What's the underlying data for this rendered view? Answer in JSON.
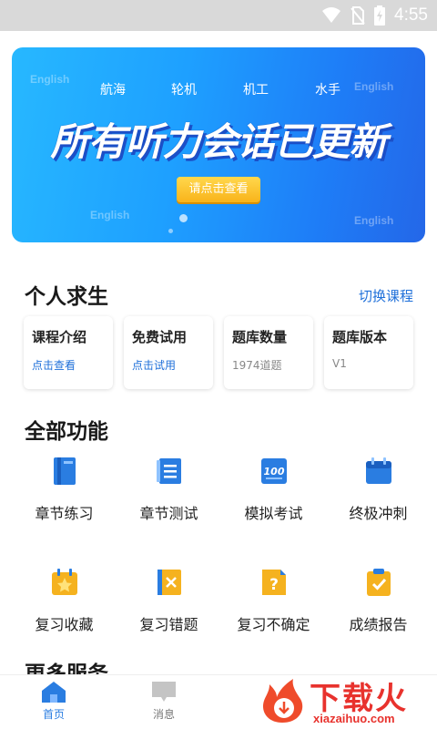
{
  "statusbar": {
    "time": "4:55",
    "icons": [
      "wifi-icon",
      "no-sim-icon",
      "battery-charging-icon"
    ]
  },
  "banner": {
    "watermark": "English",
    "categories": [
      "航海",
      "轮机",
      "机工",
      "水手"
    ],
    "headline": "所有听力会话已更新",
    "cta": "请点击查看"
  },
  "course": {
    "title": "个人求生",
    "switch_label": "切换课程",
    "cards": [
      {
        "title": "课程介绍",
        "sub": "点击查看"
      },
      {
        "title": "免费试用",
        "sub": "点击试用"
      },
      {
        "title": "题库数量",
        "sub": "1974道题"
      },
      {
        "title": "题库版本",
        "sub": "V1"
      }
    ]
  },
  "functions": {
    "title": "全部功能",
    "items": [
      {
        "label": "章节练习",
        "icon": "book-icon"
      },
      {
        "label": "章节测试",
        "icon": "list-doc-icon"
      },
      {
        "label": "模拟考试",
        "icon": "score-100-icon"
      },
      {
        "label": "终极冲刺",
        "icon": "calendar-icon"
      },
      {
        "label": "复习收藏",
        "icon": "star-calendar-icon"
      },
      {
        "label": "复习错题",
        "icon": "wrong-book-icon"
      },
      {
        "label": "复习不确定",
        "icon": "question-doc-icon"
      },
      {
        "label": "成绩报告",
        "icon": "clipboard-check-icon"
      }
    ]
  },
  "more": {
    "title": "更多服务"
  },
  "tabbar": {
    "tabs": [
      {
        "label": "首页"
      },
      {
        "label": "消息"
      }
    ]
  },
  "watermark_logo": {
    "brand": "下载火",
    "site": "xiazaihuo.com"
  },
  "colors": {
    "accent": "#1e6fd9",
    "banner_start": "#27b8ff",
    "banner_end": "#2467e8",
    "cta": "#f9b31a",
    "logo_red": "#e8322d"
  }
}
